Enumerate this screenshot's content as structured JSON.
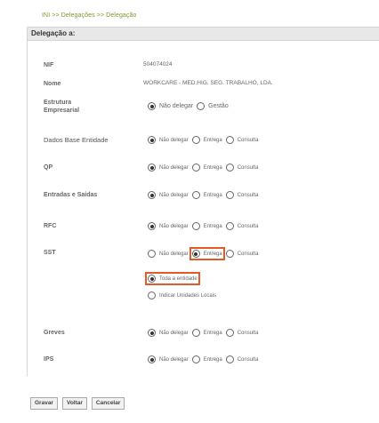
{
  "breadcrumb": "INI >> Delegações >> Delegação",
  "panel_title": "Delegação a:",
  "nif": {
    "label": "NIF",
    "value": "504074024"
  },
  "nome": {
    "label": "Nome",
    "value": "WORKCARE - MED.HIG. SEG. TRABALHO, LDA."
  },
  "estrutura": {
    "label_line1": "Estrutura",
    "label_line2": "Empresarial",
    "opt1": "Não delegar",
    "opt2": "Gestão"
  },
  "rows": [
    {
      "label": "Dados Base Entidade",
      "o1": "Não delegar",
      "o2": "Entrega",
      "o3": "Consulta"
    },
    {
      "label": "QP",
      "o1": "Não delegar",
      "o2": "Entrega",
      "o3": "Consulta"
    },
    {
      "label": "Entradas e Saídas",
      "o1": "Não delegar",
      "o2": "Entrega",
      "o3": "Consulta"
    },
    {
      "label": "RFC",
      "o1": "Não delegar",
      "o2": "Entrega",
      "o3": "Consulta"
    },
    {
      "label": "SST",
      "o1": "Não delegar",
      "o2": "Entrega",
      "o3": "Consulta"
    },
    {
      "label": "Greves",
      "o1": "Não delegar",
      "o2": "Entrega",
      "o3": "Consulta"
    },
    {
      "label": "IPS",
      "o1": "Não delegar",
      "o2": "Entrega",
      "o3": "Consulta"
    }
  ],
  "sst_scope": {
    "opt1": "Toda a entidade",
    "opt2": "Indicar Unidades Locais"
  },
  "buttons": {
    "save": "Gravar",
    "back": "Voltar",
    "cancel": "Cancelar"
  },
  "colors": {
    "highlight": "#e05a2a",
    "breadcrumb": "#7a9a2a",
    "header_bg": "#e8e8e8"
  }
}
